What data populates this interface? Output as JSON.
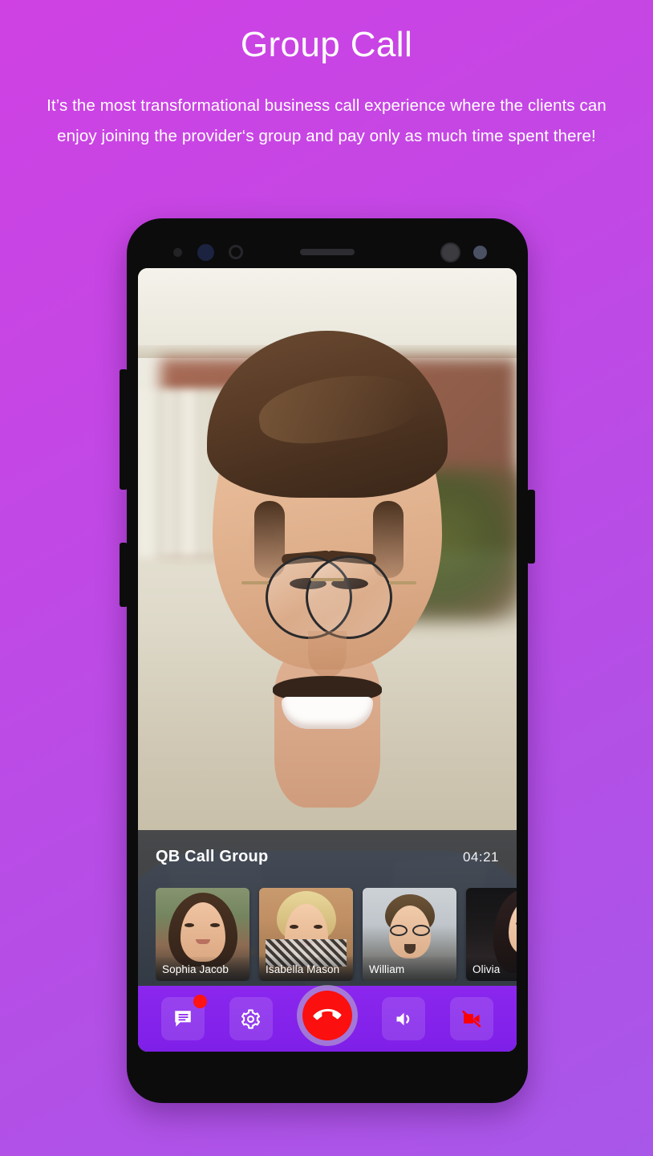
{
  "header": {
    "title": "Group Call",
    "subtitle": "It’s the most transformational business call experience where the clients can enjoy joining the provider‘s group and pay only as much time spent there!"
  },
  "colors": {
    "bg_top": "#cf41e3",
    "bg_bottom": "#a857e9",
    "control_bar": "#8b27ee",
    "end_call": "#fb0f0f",
    "badge": "#ff1313",
    "video_off": "#ff0000",
    "panel": "#242830"
  },
  "phone": {
    "bezel_color": "#0c0c0d",
    "sensors": [
      {
        "name": "proximity-sensor-dot"
      },
      {
        "name": "light-sensor"
      },
      {
        "name": "sensor-ring"
      },
      {
        "name": "earpiece-speaker-grille"
      },
      {
        "name": "front-camera"
      },
      {
        "name": "secondary-sensor"
      }
    ],
    "side_buttons": [
      {
        "name": "volume-rocker",
        "side": "left"
      },
      {
        "name": "power-button",
        "side": "left"
      },
      {
        "name": "assistant-button",
        "side": "right"
      }
    ]
  },
  "call": {
    "group_name": "QB Call Group",
    "duration": "04:21",
    "main_speaker_alt": "Smiling man with glasses on video call",
    "participants": [
      {
        "name": "Sophia Jacob",
        "face": "f1"
      },
      {
        "name": "Isabella Mason",
        "face": "f2"
      },
      {
        "name": "William",
        "face": "f3"
      },
      {
        "name": "Olivia",
        "face": "f4"
      }
    ],
    "controls": [
      {
        "name": "chat-button",
        "icon": "chat-icon",
        "label": "Chat",
        "badge": true
      },
      {
        "name": "settings-button",
        "icon": "gear-icon",
        "label": "Settings",
        "badge": false
      },
      {
        "name": "end-call-button",
        "icon": "hangup-icon",
        "label": "End Call",
        "badge": false
      },
      {
        "name": "speaker-button",
        "icon": "speaker-icon",
        "label": "Speaker",
        "badge": false
      },
      {
        "name": "video-off-button",
        "icon": "video-off-icon",
        "label": "Video Off",
        "badge": false
      }
    ]
  }
}
